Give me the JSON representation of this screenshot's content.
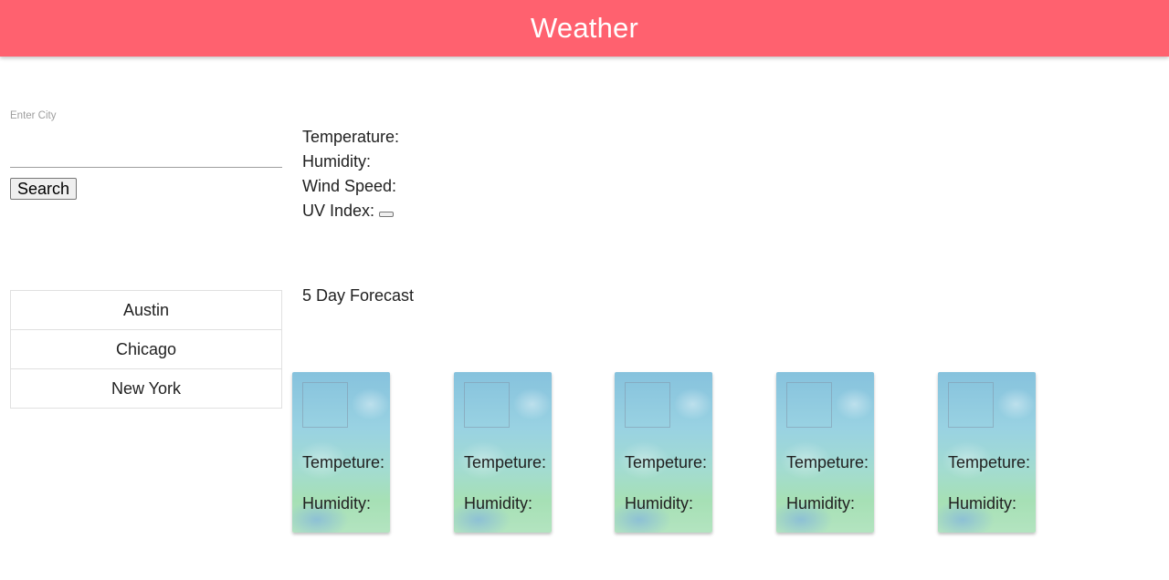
{
  "header": {
    "title": "Weather"
  },
  "search": {
    "label": "Enter City",
    "value": "",
    "button_label": "Search"
  },
  "history": {
    "cities": [
      "Austin",
      "Chicago",
      "New York"
    ]
  },
  "current": {
    "temperature_label": "Temperature:",
    "humidity_label": "Humidity:",
    "wind_label": "Wind Speed:",
    "uv_label": "UV Index:"
  },
  "forecast": {
    "title": "5 Day Forecast",
    "cards": [
      {
        "temp_label": "Tempeture:",
        "humidity_label": "Humidity:"
      },
      {
        "temp_label": "Tempeture:",
        "humidity_label": "Humidity:"
      },
      {
        "temp_label": "Tempeture:",
        "humidity_label": "Humidity:"
      },
      {
        "temp_label": "Tempeture:",
        "humidity_label": "Humidity:"
      },
      {
        "temp_label": "Tempeture:",
        "humidity_label": "Humidity:"
      }
    ]
  },
  "colors": {
    "navbar": "#ff616f",
    "navbar_text": "#ffffff"
  }
}
